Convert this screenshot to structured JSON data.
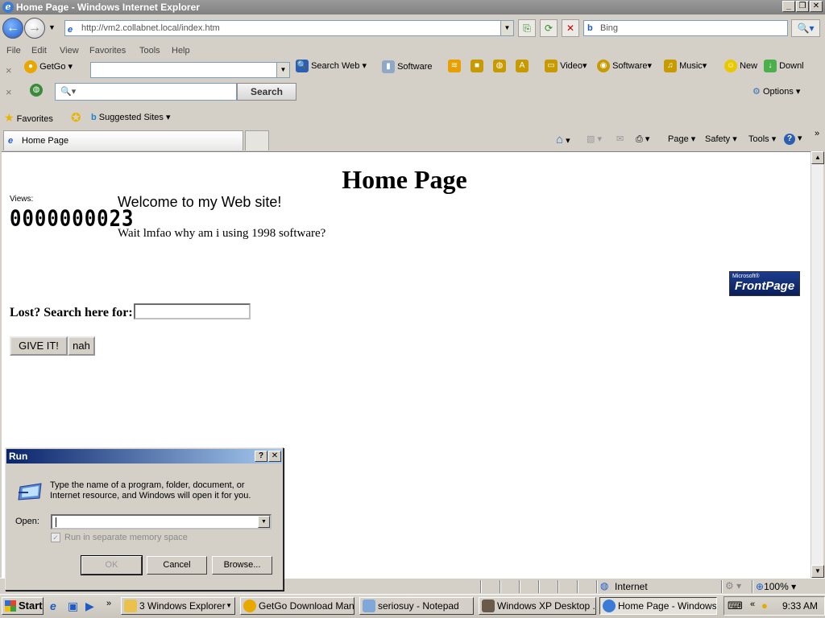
{
  "window": {
    "title": "Home Page - Windows Internet Explorer"
  },
  "nav": {
    "address": "http://vm2.collabnet.local/index.htm",
    "search_placeholder": "Bing"
  },
  "menu": {
    "items": [
      "File",
      "Edit",
      "View",
      "Favorites",
      "Tools",
      "Help"
    ]
  },
  "toolbar": {
    "getgo": "GetGo",
    "search_web": "Search Web",
    "software": "Software",
    "video": "Video",
    "software2": "Software",
    "music": "Music",
    "new": "New",
    "download": "Downl",
    "search_btn": "Search",
    "options": "Options"
  },
  "favorites": {
    "label": "Favorites",
    "suggested": "Suggested Sites"
  },
  "tab": {
    "label": "Home Page"
  },
  "commandbar": {
    "page": "Page",
    "safety": "Safety",
    "tools": "Tools"
  },
  "webpage": {
    "title": "Home Page",
    "views_label": "Views:",
    "counter": "0000000023",
    "welcome": "Welcome to my Web site!",
    "subtext": "Wait lmfao why am i using 1998 software?",
    "frontpage_small": "Microsoft®",
    "frontpage_big": "FrontPage",
    "lost_label": "Lost? Search here for:",
    "give_it": "GIVE IT!",
    "nah": "nah"
  },
  "status": {
    "zone": "Internet",
    "zoom": "100%"
  },
  "run_dialog": {
    "title": "Run",
    "description": "Type the name of a program, folder, document, or Internet resource, and Windows will open it for you.",
    "open_label": "Open:",
    "open_value": "",
    "checkbox_label": "Run in separate memory space",
    "ok": "OK",
    "cancel": "Cancel",
    "browse": "Browse..."
  },
  "taskbar": {
    "start": "Start",
    "tasks": [
      "3 Windows Explorer",
      "GetGo Download Man...",
      "seriosuy - Notepad",
      "Windows XP Desktop ...",
      "Home Page - Windows..."
    ],
    "time": "9:33 AM"
  }
}
